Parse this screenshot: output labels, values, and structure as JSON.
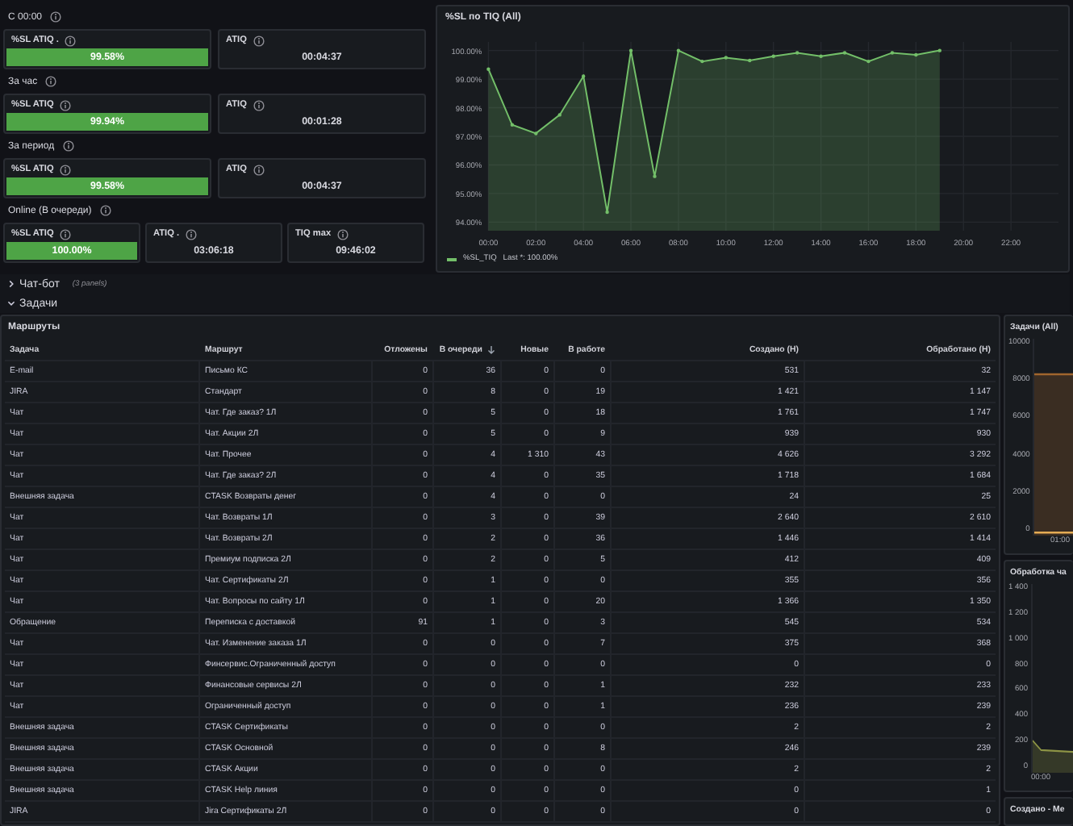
{
  "stat_groups": [
    {
      "label": "С 00:00",
      "panels": [
        {
          "title": "%SL ATIQ .",
          "value": "99.58%",
          "color": "#4ea446"
        },
        {
          "title": "ATIQ",
          "value": "00:04:37"
        }
      ]
    },
    {
      "label": "За час",
      "panels": [
        {
          "title": "%SL ATIQ",
          "value": "99.94%",
          "color": "#4ea446"
        },
        {
          "title": "ATIQ",
          "value": "00:01:28"
        }
      ]
    },
    {
      "label": "За период",
      "panels": [
        {
          "title": "%SL ATIQ",
          "value": "99.58%",
          "color": "#4ea446"
        },
        {
          "title": "ATIQ",
          "value": "00:04:37"
        }
      ]
    },
    {
      "label": "Online (В очереди)",
      "panels": [
        {
          "title": "%SL ATIQ",
          "value": "100.00%",
          "color": "#4ea446"
        },
        {
          "title": "ATIQ .",
          "value": "03:06:18"
        },
        {
          "title": "TIQ max",
          "value": "09:46:02"
        }
      ]
    }
  ],
  "sl_chart": {
    "title": "%SL по TIQ (All)",
    "legend_stat": "Last *: 100.00%",
    "chart_data": {
      "type": "area",
      "grid": true,
      "x": [
        0,
        1,
        2,
        3,
        4,
        5,
        6,
        7,
        8,
        9,
        10,
        11,
        12,
        13,
        14,
        15,
        16,
        17,
        18,
        19
      ],
      "xlim": [
        0,
        24
      ],
      "ylim": [
        93.7,
        100.3
      ],
      "xticks": [
        {
          "value": 0,
          "label": "00:00"
        },
        {
          "value": 2,
          "label": "02:00"
        },
        {
          "value": 4,
          "label": "04:00"
        },
        {
          "value": 6,
          "label": "06:00"
        },
        {
          "value": 8,
          "label": "08:00"
        },
        {
          "value": 10,
          "label": "10:00"
        },
        {
          "value": 12,
          "label": "12:00"
        },
        {
          "value": 14,
          "label": "14:00"
        },
        {
          "value": 16,
          "label": "16:00"
        },
        {
          "value": 18,
          "label": "18:00"
        },
        {
          "value": 20,
          "label": "20:00"
        },
        {
          "value": 22,
          "label": "22:00"
        }
      ],
      "yticks": [
        {
          "value": 94,
          "label": "94.00%"
        },
        {
          "value": 95,
          "label": "95.00%"
        },
        {
          "value": 96,
          "label": "96.00%"
        },
        {
          "value": 97,
          "label": "97.00%"
        },
        {
          "value": 98,
          "label": "98.00%"
        },
        {
          "value": 99,
          "label": "99.00%"
        },
        {
          "value": 100,
          "label": "100.00%"
        }
      ],
      "series": [
        {
          "name": "%SL_TIQ",
          "color": "#73bf69",
          "values": [
            99.35,
            97.4,
            97.1,
            97.75,
            99.1,
            94.35,
            100,
            95.6,
            100,
            99.62,
            99.75,
            99.65,
            99.8,
            99.92,
            99.8,
            99.92,
            99.62,
            99.92,
            99.85,
            100
          ]
        }
      ]
    }
  },
  "rows": [
    {
      "title": "Чат-бот",
      "count": "(3 panels)",
      "expanded": false
    },
    {
      "title": "Задачи",
      "expanded": true
    }
  ],
  "routes_table": {
    "title": "Маршруты",
    "columns": [
      {
        "label": "Задача",
        "kind": "text"
      },
      {
        "label": "Маршрут",
        "kind": "text"
      },
      {
        "label": "Отложены",
        "kind": "number"
      },
      {
        "label": "В очереди",
        "kind": "number",
        "sorted": true
      },
      {
        "label": "Новые",
        "kind": "number"
      },
      {
        "label": "В работе",
        "kind": "number"
      },
      {
        "label": "Создано (Н)",
        "kind": "number"
      },
      {
        "label": "Обработано (Н)",
        "kind": "number"
      }
    ],
    "rows": [
      [
        "E-mail",
        "Письмо КС",
        "0",
        "36",
        "0",
        "0",
        "531",
        "32"
      ],
      [
        "JIRA",
        "Стандарт",
        "0",
        "8",
        "0",
        "19",
        "1 421",
        "1 147"
      ],
      [
        "Чат",
        "Чат. Где заказ? 1Л",
        "0",
        "5",
        "0",
        "18",
        "1 761",
        "1 747"
      ],
      [
        "Чат",
        "Чат. Акции 2Л",
        "0",
        "5",
        "0",
        "9",
        "939",
        "930"
      ],
      [
        "Чат",
        "Чат. Прочее",
        "0",
        "4",
        "1 310",
        "43",
        "4 626",
        "3 292"
      ],
      [
        "Чат",
        "Чат. Где заказ? 2Л",
        "0",
        "4",
        "0",
        "35",
        "1 718",
        "1 684"
      ],
      [
        "Внешняя задача",
        "CTASK Возвраты денег",
        "0",
        "4",
        "0",
        "0",
        "24",
        "25"
      ],
      [
        "Чат",
        "Чат. Возвраты 1Л",
        "0",
        "3",
        "0",
        "39",
        "2 640",
        "2 610"
      ],
      [
        "Чат",
        "Чат. Возвраты 2Л",
        "0",
        "2",
        "0",
        "36",
        "1 446",
        "1 414"
      ],
      [
        "Чат",
        "Премиум подписка 2Л",
        "0",
        "2",
        "0",
        "5",
        "412",
        "409"
      ],
      [
        "Чат",
        "Чат. Сертификаты 2Л",
        "0",
        "1",
        "0",
        "0",
        "355",
        "356"
      ],
      [
        "Чат",
        "Чат. Вопросы по сайту 1Л",
        "0",
        "1",
        "0",
        "20",
        "1 366",
        "1 350"
      ],
      [
        "Обращение",
        "Переписка с доставкой",
        "91",
        "1",
        "0",
        "3",
        "545",
        "534"
      ],
      [
        "Чат",
        "Чат. Изменение заказа 1Л",
        "0",
        "0",
        "0",
        "7",
        "375",
        "368"
      ],
      [
        "Чат",
        "Финсервис.Ограниченный доступ",
        "0",
        "0",
        "0",
        "0",
        "0",
        "0"
      ],
      [
        "Чат",
        "Финансовые сервисы 2Л",
        "0",
        "0",
        "0",
        "1",
        "232",
        "233"
      ],
      [
        "Чат",
        "Ограниченный доступ",
        "0",
        "0",
        "0",
        "1",
        "236",
        "239"
      ],
      [
        "Внешняя задача",
        "CTASK Сертификаты",
        "0",
        "0",
        "0",
        "0",
        "2",
        "2"
      ],
      [
        "Внешняя задача",
        "CTASK Основной",
        "0",
        "0",
        "0",
        "8",
        "246",
        "239"
      ],
      [
        "Внешняя задача",
        "CTASK Акции",
        "0",
        "0",
        "0",
        "0",
        "2",
        "2"
      ],
      [
        "Внешняя задача",
        "CTASK Help линия",
        "0",
        "0",
        "0",
        "0",
        "0",
        "1"
      ],
      [
        "JIRA",
        "Jira Сертификаты 2Л",
        "0",
        "0",
        "0",
        "0",
        "0",
        "0"
      ]
    ]
  },
  "side_panels": [
    {
      "title": "Задачи (All)",
      "kind": "flat-area",
      "y_labels": [
        "10000",
        "8000",
        "6000",
        "4000",
        "2000",
        "0"
      ],
      "x_label": "01:00"
    },
    {
      "title": "Обработка ча",
      "kind": "falling-area",
      "y_labels": [
        "1 400",
        "1 200",
        "1 000",
        "800",
        "600",
        "400",
        "200",
        "0"
      ],
      "x_label": "00:00"
    },
    {
      "title": "Создано - Ме",
      "kind": "empty"
    }
  ]
}
